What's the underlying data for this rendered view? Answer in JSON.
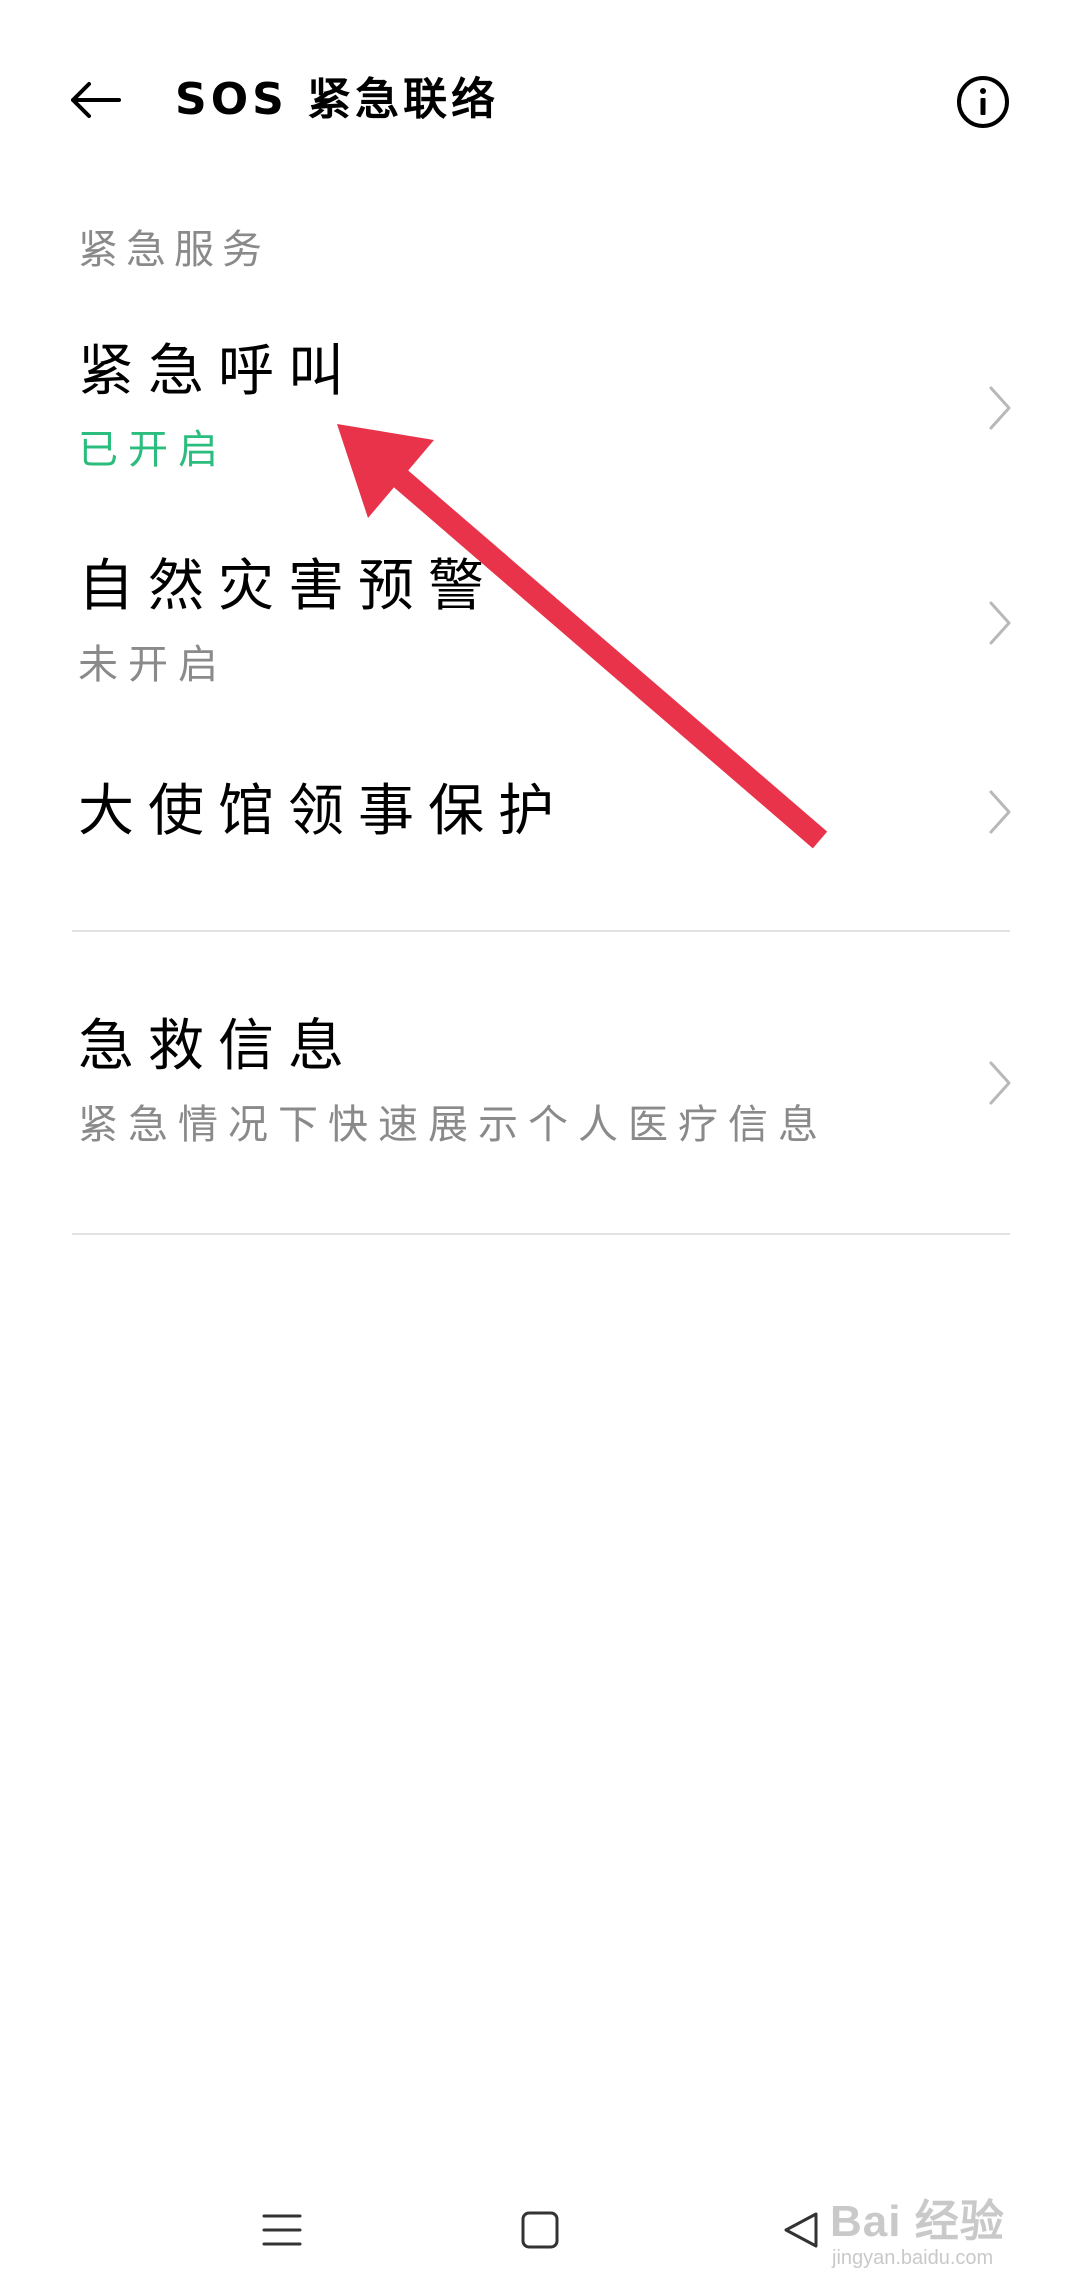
{
  "header": {
    "title": "SOS 紧急联络",
    "back_icon": "arrow-left-icon",
    "info_icon": "info-circle-icon"
  },
  "section": {
    "label": "紧急服务"
  },
  "items": [
    {
      "title": "紧急呼叫",
      "subtitle": "已开启",
      "subtitle_color": "#2bbd7e"
    },
    {
      "title": "自然灾害预警",
      "subtitle": "未开启",
      "subtitle_color": "#8a8a8a"
    },
    {
      "title": "大使馆领事保护",
      "subtitle": ""
    },
    {
      "title": "急救信息",
      "subtitle": "紧急情况下快速展示个人医疗信息",
      "subtitle_color": "#8a8a8a"
    }
  ],
  "annotation": {
    "arrow_color": "#e8334a"
  },
  "navbar": {
    "menu_icon": "menu-icon",
    "home_icon": "home-square-icon",
    "back_icon": "back-triangle-icon"
  },
  "watermark": {
    "brand": "Bai 经验",
    "url": "jingyan.baidu.com"
  }
}
